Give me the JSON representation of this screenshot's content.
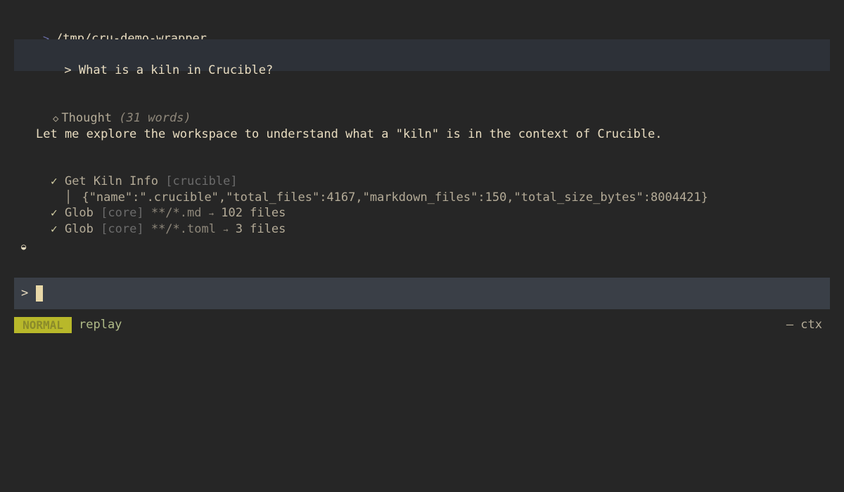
{
  "path": {
    "caret": ">",
    "text": "/tmp/cru-demo-wrapper"
  },
  "user_message": {
    "caret": ">",
    "text": "What is a kiln in Crucible?"
  },
  "thought": {
    "icon": "◇",
    "label": "Thought",
    "meta": "(31 words)",
    "body": "Let me explore the workspace to understand what a \"kiln\" is in the context of Crucible."
  },
  "tools": [
    {
      "status": "✓",
      "name": "Get Kiln Info",
      "tag": "[crucible]",
      "arg": "",
      "arrow": "",
      "result": ""
    },
    {
      "status": "✓",
      "name": "Glob",
      "tag": "[core]",
      "arg": "**/*.md",
      "arrow": "→",
      "result": "102 files"
    },
    {
      "status": "✓",
      "name": "Glob",
      "tag": "[core]",
      "arg": "**/*.toml",
      "arrow": "→",
      "result": "3 files"
    }
  ],
  "tool_result": {
    "bar": "│",
    "text": "{\"name\":\".crucible\",\"total_files\":4167,\"markdown_files\":150,\"total_size_bytes\":8004421}"
  },
  "spinner": "◒",
  "input": {
    "prompt": ">",
    "value": ""
  },
  "status": {
    "mode": "NORMAL",
    "label": "replay",
    "ctx": "— ctx"
  },
  "colors": {
    "background": "#262626",
    "text": "#e8dcc0",
    "mode_badge": "#b8b82a",
    "input_bar": "#3a3f47",
    "message_bar": "#2d3138"
  }
}
